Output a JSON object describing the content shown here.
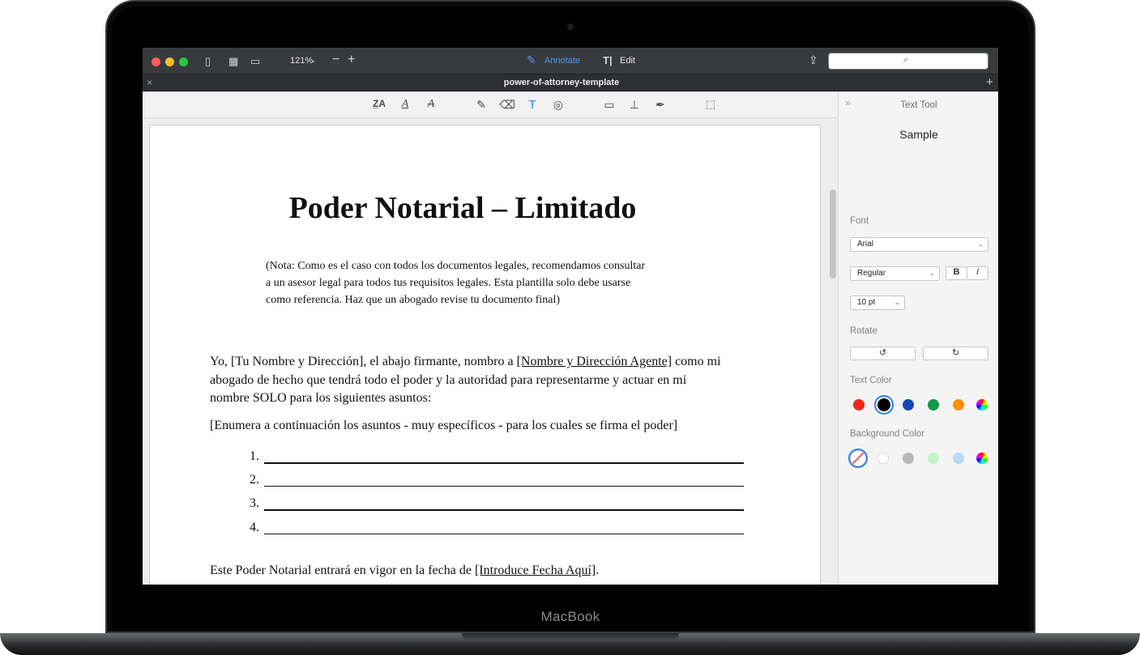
{
  "device": {
    "brand": "MacBook"
  },
  "app": {
    "zoom": "121%",
    "modes": {
      "annotate": "Annotate",
      "edit": "Edit"
    },
    "tab_title": "power-of-attorney-template",
    "search_icon": "magnifier-icon"
  },
  "toolbar": {
    "tools": [
      "text-markup-icon",
      "underline-icon",
      "strikethrough-icon",
      "pencil-icon",
      "eraser-icon",
      "text-tool-icon",
      "shapes-icon",
      "note-icon",
      "stamp-icon",
      "signature-icon",
      "selection-icon"
    ]
  },
  "document": {
    "title": "Poder Notarial – Limitado",
    "note_lines": [
      "(Nota: Como es el caso con todos los documentos legales, recomendamos consultar",
      "a un asesor legal para todos tus requisitos legales. Esta plantilla solo debe usarse",
      "como referencia. Haz que un abogado revise tu documento final)"
    ],
    "para1_a": "Yo, [Tu Nombre y Dirección], el abajo firmante, nombro a ",
    "para1_link": "[Nombre y Dirección Agente]",
    "para1_b": " como mi",
    "para1_line2": "abogado de hecho que tendrá todo el poder y la autoridad para representarme y actuar en mi",
    "para1_line3": "nombre SOLO para los siguientes asuntos:",
    "para2": "[Enumera a continuación los asuntos - muy específicos - para los cuales se firma el poder]",
    "list_numbers": [
      "1.",
      "2.",
      "3.",
      "4."
    ],
    "para3_a": "Este Poder Notarial entrará en vigor en la fecha de ",
    "para3_link": "[Introduce Fecha Aquí]",
    "para3_b": "."
  },
  "sidebar": {
    "title": "Text Tool",
    "sample": "Sample",
    "font_label": "Font",
    "font_value": "Arial",
    "style_value": "Regular",
    "bold_label": "B",
    "italic_label": "I",
    "size_value": "10 pt",
    "rotate_label": "Rotate",
    "text_color_label": "Text Color",
    "text_colors": [
      "#f0271a",
      "#000000",
      "#1448b3",
      "#14984a",
      "#ff8f00"
    ],
    "bg_color_label": "Background Color",
    "bg_colors": [
      "#ffffff",
      "#b8b8b8",
      "#c3f2c6",
      "#b9d9f7"
    ]
  }
}
